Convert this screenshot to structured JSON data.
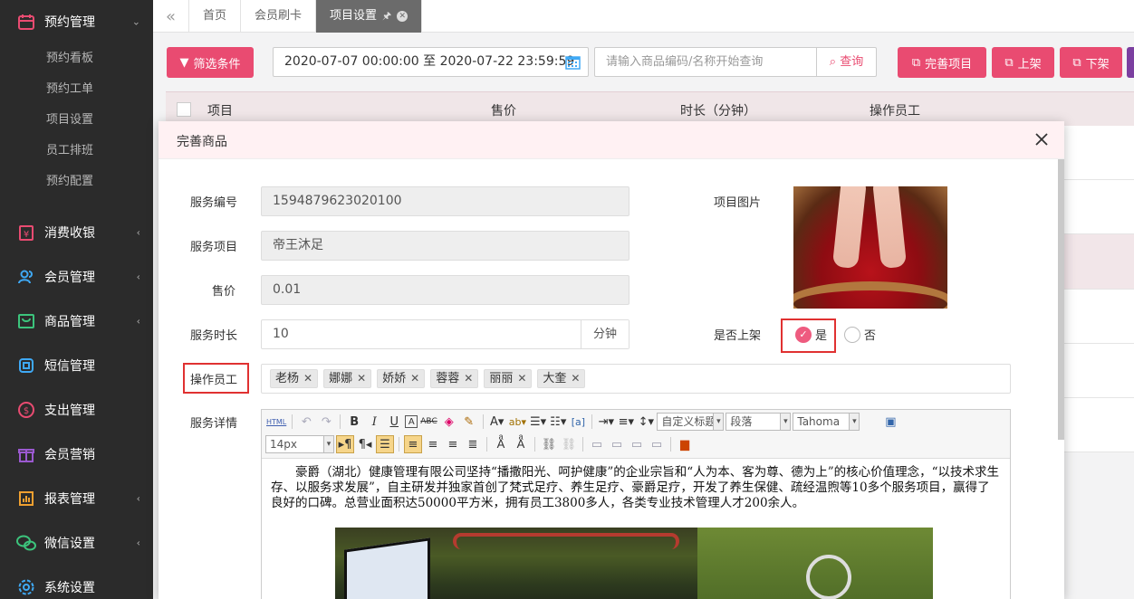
{
  "sidebar": {
    "groups": [
      {
        "label": "预约管理",
        "icon": "calendar-icon",
        "expanded": true
      },
      {
        "label": "消费收银",
        "icon": "cashier-icon"
      },
      {
        "label": "会员管理",
        "icon": "members-icon"
      },
      {
        "label": "商品管理",
        "icon": "goods-icon"
      },
      {
        "label": "短信管理",
        "icon": "sms-icon"
      },
      {
        "label": "支出管理",
        "icon": "expense-icon"
      },
      {
        "label": "会员营销",
        "icon": "gift-icon"
      },
      {
        "label": "报表管理",
        "icon": "report-icon"
      },
      {
        "label": "微信设置",
        "icon": "wechat-icon"
      },
      {
        "label": "系统设置",
        "icon": "gear-icon"
      }
    ],
    "subitems": [
      "预约看板",
      "预约工单",
      "项目设置",
      "员工排班",
      "预约配置"
    ]
  },
  "tabs": {
    "items": [
      "首页",
      "会员刷卡",
      "项目设置"
    ]
  },
  "toolbar": {
    "filter_label": "筛选条件",
    "date_range": "2020-07-07 00:00:00 至 2020-07-22 23:59:59",
    "search_placeholder": "请输入商品编码/名称开始查询",
    "query_label": "查询",
    "complete_label": "完善项目",
    "on_shelf_label": "上架",
    "off_shelf_label": "下架"
  },
  "table": {
    "headers": [
      "项目",
      "售价",
      "时长（分钟）",
      "操作员工"
    ]
  },
  "modal": {
    "title": "完善商品",
    "fields": {
      "service_no_label": "服务编号",
      "service_no": "1594879623020100",
      "service_item_label": "服务项目",
      "service_item": "帝王沐足",
      "price_label": "售价",
      "price": "0.01",
      "duration_label": "服务时长",
      "duration": "10",
      "duration_unit": "分钟",
      "staff_label": "操作员工",
      "detail_label": "服务详情",
      "image_label": "项目图片",
      "on_shelf_label": "是否上架",
      "yes": "是",
      "no": "否"
    },
    "staff": [
      "老杨",
      "娜娜",
      "娇娇",
      "蓉蓉",
      "丽丽",
      "大奎"
    ],
    "editor": {
      "html_btn": "HTML",
      "style_select": "自定义标题",
      "paragraph_select": "段落",
      "font_select": "Tahoma",
      "size_select": "14px",
      "content": "豪爵（湖北）健康管理有限公司坚持“播撒阳光、呵护健康”的企业宗旨和“人为本、客为尊、德为上”的核心价值理念，“以技术求生存、以服务求发展”，自主研发并独家首创了梵式足疗、养生足疗、豪爵足疗，开发了养生保健、疏经温煦等10多个服务项目，赢得了良好的口碑。总营业面积达50000平方米，拥有员工3800多人，各类专业技术管理人才200余人。"
    }
  }
}
